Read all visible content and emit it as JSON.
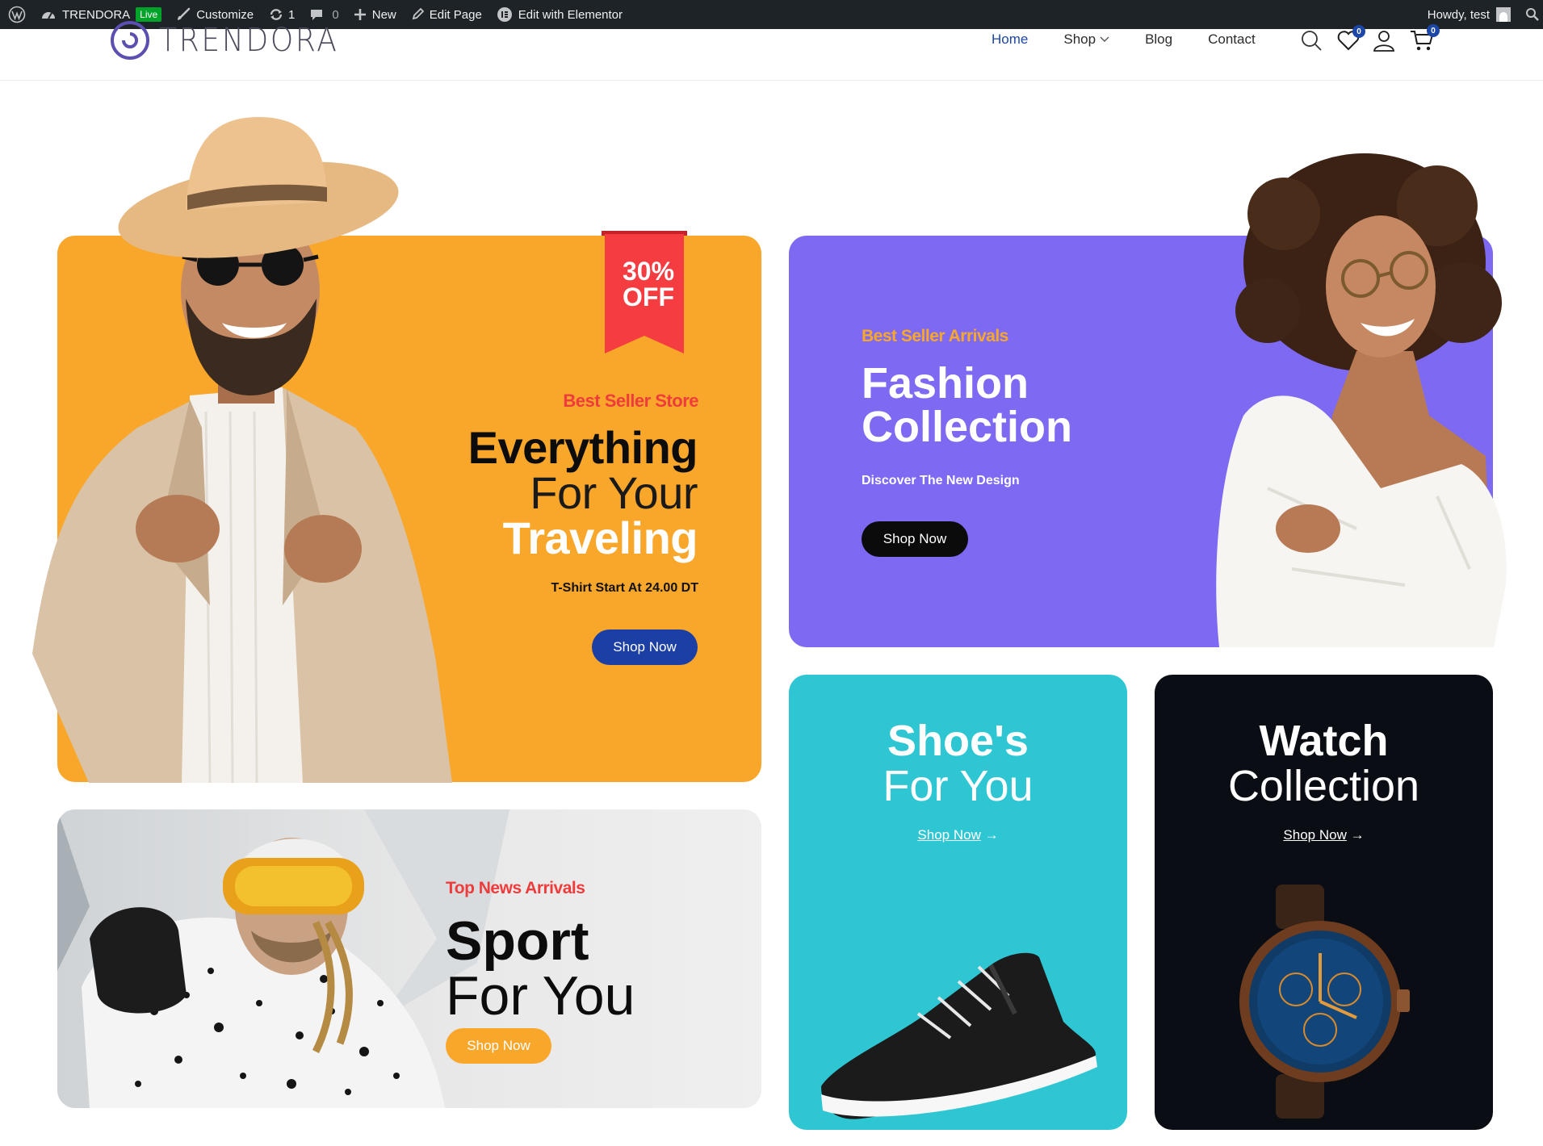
{
  "admin_bar": {
    "site_name": "TRENDORA",
    "live_badge": "Live",
    "customize": "Customize",
    "updates_count": "1",
    "comments_count": "0",
    "new": "New",
    "edit_page": "Edit Page",
    "edit_elementor": "Edit with Elementor",
    "howdy": "Howdy, test",
    "bg_color": "#1d2327"
  },
  "header": {
    "logo_text": "TRENDORA",
    "nav": [
      {
        "label": "Home",
        "active": true
      },
      {
        "label": "Shop",
        "has_dropdown": true
      },
      {
        "label": "Blog"
      },
      {
        "label": "Contact"
      }
    ],
    "icons": [
      "search-icon",
      "wishlist-icon",
      "user-icon",
      "cart-icon"
    ],
    "wishlist_count": "0",
    "cart_count": "0",
    "accent_color": "#1c46a8"
  },
  "banners": {
    "traveling": {
      "discount_line1": "30%",
      "discount_line2": "OFF",
      "subtitle": "Best Seller Store",
      "heading_line1": "Everything",
      "heading_line2": "For Your",
      "heading_line3": "Traveling",
      "note": "T-Shirt Start At 24.00 DT",
      "button": "Shop Now",
      "bg_color": "#f9a72b"
    },
    "fashion": {
      "subtitle": "Best Seller Arrivals",
      "heading_line1": "Fashion",
      "heading_line2": "Collection",
      "note": "Discover The New Design",
      "button": "Shop Now",
      "bg_color": "#7d69f2"
    },
    "sport": {
      "subtitle": "Top News Arrivals",
      "heading_line1": "Sport",
      "heading_line2": "For You",
      "button": "Shop Now"
    },
    "shoes": {
      "heading_line1": "Shoe's",
      "heading_line2": "For You",
      "link": "Shop Now",
      "bg_color": "#2fc6d4"
    },
    "watch": {
      "heading_line1": "Watch",
      "heading_line2": "Collection",
      "link": "Shop Now",
      "bg_color": "#0a0e14"
    }
  }
}
